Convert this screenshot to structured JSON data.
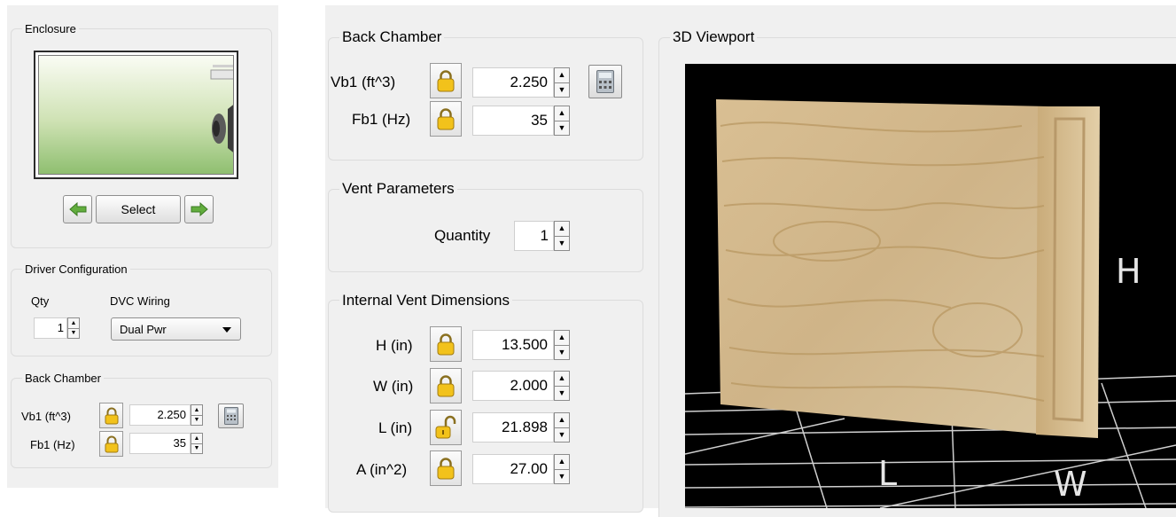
{
  "left_panel": {
    "enclosure": {
      "group_title": "Enclosure",
      "prev_icon": "left-arrow-icon",
      "select_label": "Select",
      "next_icon": "right-arrow-icon"
    },
    "driver_config": {
      "group_title": "Driver Configuration",
      "qty_label": "Qty",
      "qty_value": "1",
      "dvc_label": "DVC Wiring",
      "dvc_value": "Dual Pwr"
    },
    "back_chamber": {
      "group_title": "Back Chamber",
      "vb1_label": "Vb1 (ft^3)",
      "vb1_value": "2.250",
      "fb1_label": "Fb1 (Hz)",
      "fb1_value": "35"
    }
  },
  "main_panel": {
    "back_chamber": {
      "group_title": "Back Chamber",
      "vb1_label": "Vb1 (ft^3)",
      "vb1_value": "2.250",
      "fb1_label": "Fb1 (Hz)",
      "fb1_value": "35"
    },
    "vent_parameters": {
      "group_title": "Vent Parameters",
      "quantity_label": "Quantity",
      "quantity_value": "1"
    },
    "internal_vent": {
      "group_title": "Internal Vent Dimensions",
      "h_label": "H (in)",
      "h_value": "13.500",
      "w_label": "W (in)",
      "w_value": "2.000",
      "l_label": "L (in)",
      "l_value": "21.898",
      "a_label": "A (in^2)",
      "a_value": "27.00"
    }
  },
  "viewport": {
    "group_title": "3D Viewport",
    "h_axis": "H",
    "w_axis": "W",
    "l_axis": "L"
  },
  "colors": {
    "panel_bg": "#f0f0f0",
    "lock_yellow": "#f2c21b",
    "arrow_green": "#5aa63a",
    "viewport_bg": "#000000",
    "wood": "#d6b98a"
  }
}
